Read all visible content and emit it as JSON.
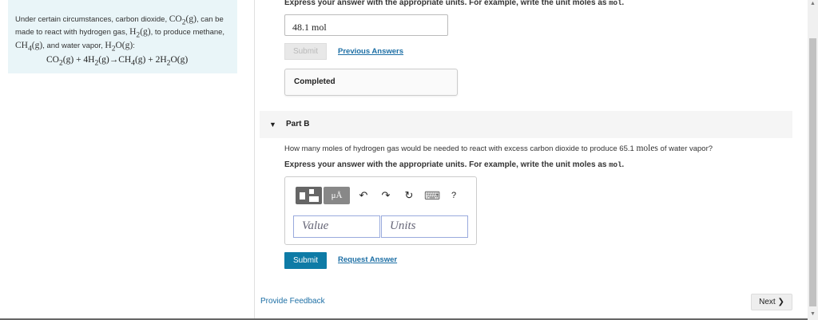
{
  "problem": {
    "text_1": "Under certain circumstances, carbon dioxide, ",
    "co2": "CO",
    "co2_sub": "2",
    "state_g": "(g)",
    "text_2": ", can be made to react with hydrogen gas, ",
    "h2": "H",
    "h2_sub": "2",
    "text_3": ", to produce methane, ",
    "ch4": "CH",
    "ch4_sub": "4",
    "text_4": ", and water vapor, ",
    "h2o_h": "H",
    "h2o_sub": "2",
    "h2o_o": "O",
    "text_5": ":",
    "equation": {
      "t1": "CO",
      "s1": "2",
      "t2": "(g) + 4H",
      "s2": "2",
      "t3": "(g)→CH",
      "s3": "4",
      "t4": "(g) + 2H",
      "s4": "2",
      "t5": "O(g)"
    }
  },
  "part_a": {
    "instruction": "Express your answer with the appropriate units. For example, write the unit moles as ",
    "unit_example": "mol",
    "instruction_end": ".",
    "answer_value": "48.1 mol",
    "submit_label": "Submit",
    "previous_answers_label": "Previous Answers",
    "status_label": "Completed"
  },
  "part_b": {
    "title": "Part B",
    "question_1": "How many moles of hydrogen gas would be needed to react with excess carbon dioxide to produce 65.1 ",
    "question_unit": "moles",
    "question_2": " of water vapor?",
    "instruction": "Express your answer with the appropriate units. For example, write the unit moles as ",
    "unit_example": "mol",
    "instruction_end": ".",
    "toolbar": {
      "mu_label": "μÅ",
      "undo": "↶",
      "redo": "↷",
      "reset": "↻",
      "keyboard": "⌨",
      "help": "?"
    },
    "value_placeholder": "Value",
    "units_placeholder": "Units",
    "submit_label": "Submit",
    "request_answer_label": "Request Answer"
  },
  "footer": {
    "feedback_label": "Provide Feedback",
    "next_label": "Next ❯"
  }
}
